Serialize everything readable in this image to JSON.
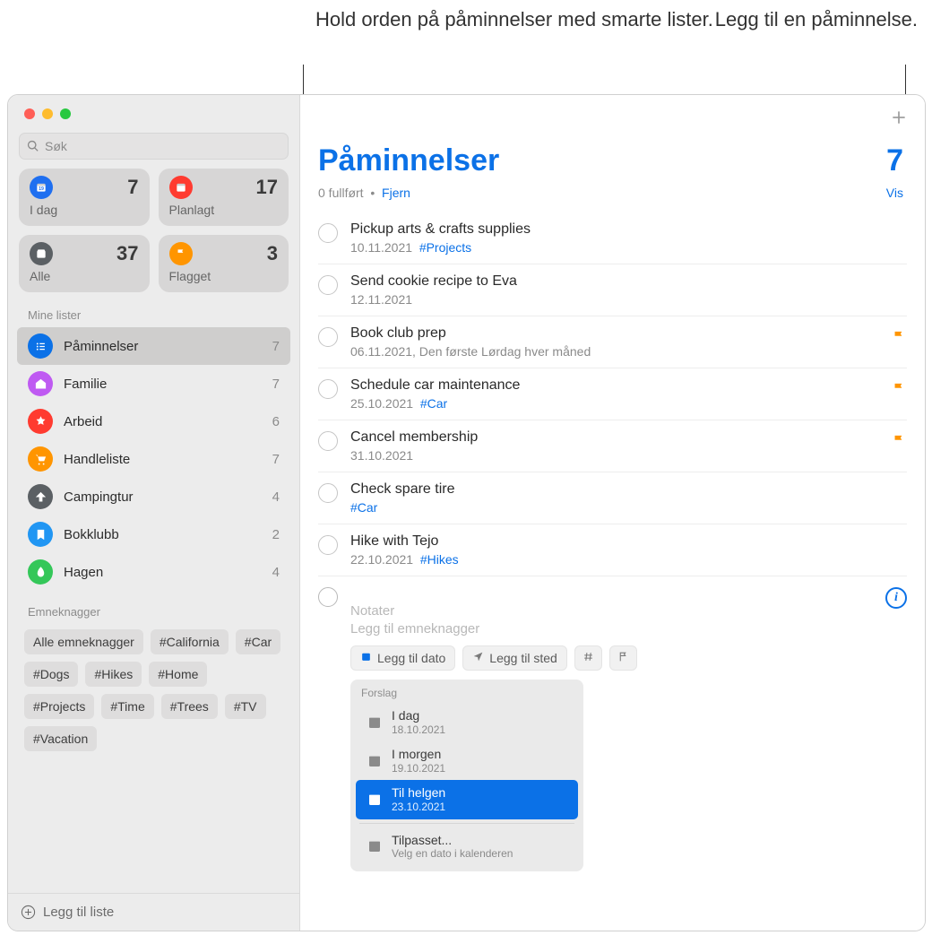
{
  "annotations": {
    "smartLists": "Hold orden på påminnelser med smarte lister.",
    "addReminder": "Legg til en påminnelse."
  },
  "sidebar": {
    "searchPlaceholder": "Søk",
    "smart": [
      {
        "label": "I dag",
        "count": "7",
        "color": "#1f6ff0"
      },
      {
        "label": "Planlagt",
        "count": "17",
        "color": "#ff3b30"
      },
      {
        "label": "Alle",
        "count": "37",
        "color": "#5b6064"
      },
      {
        "label": "Flagget",
        "count": "3",
        "color": "#ff9500"
      }
    ],
    "myListsHeader": "Mine lister",
    "lists": [
      {
        "name": "Påminnelser",
        "count": "7",
        "color": "#0b71e7",
        "selected": true
      },
      {
        "name": "Familie",
        "count": "7",
        "color": "#bf5af2"
      },
      {
        "name": "Arbeid",
        "count": "6",
        "color": "#ff3b30"
      },
      {
        "name": "Handleliste",
        "count": "7",
        "color": "#ff9500"
      },
      {
        "name": "Campingtur",
        "count": "4",
        "color": "#5b6064"
      },
      {
        "name": "Bokklubb",
        "count": "2",
        "color": "#2196f3"
      },
      {
        "name": "Hagen",
        "count": "4",
        "color": "#34c759"
      }
    ],
    "tagsHeader": "Emneknagger",
    "tags": [
      "Alle emneknagger",
      "#California",
      "#Car",
      "#Dogs",
      "#Hikes",
      "#Home",
      "#Projects",
      "#Time",
      "#Trees",
      "#TV",
      "#Vacation"
    ],
    "addList": "Legg til liste"
  },
  "main": {
    "title": "Påminnelser",
    "count": "7",
    "completedText": "0 fullført",
    "clearText": "Fjern",
    "showText": "Vis",
    "reminders": [
      {
        "title": "Pickup arts & crafts supplies",
        "date": "10.11.2021",
        "tag": "#Projects",
        "flag": false
      },
      {
        "title": "Send cookie recipe to Eva",
        "date": "12.11.2021",
        "tag": "",
        "flag": false
      },
      {
        "title": "Book club prep",
        "date": "06.11.2021, Den første Lørdag hver måned",
        "tag": "",
        "flag": true
      },
      {
        "title": "Schedule car maintenance",
        "date": "25.10.2021",
        "tag": "#Car",
        "flag": true
      },
      {
        "title": "Cancel membership",
        "date": "31.10.2021",
        "tag": "",
        "flag": true
      },
      {
        "title": "Check spare tire",
        "date": "",
        "tag": "#Car",
        "flag": false
      },
      {
        "title": "Hike with Tejo",
        "date": "22.10.2021",
        "tag": "#Hikes",
        "flag": false
      }
    ],
    "newItem": {
      "notesPlaceholder": "Notater",
      "tagsPlaceholder": "Legg til emneknagger",
      "addDate": "Legg til dato",
      "addLocation": "Legg til sted"
    },
    "suggestions": {
      "header": "Forslag",
      "items": [
        {
          "title": "I dag",
          "sub": "18.10.2021",
          "selected": false
        },
        {
          "title": "I morgen",
          "sub": "19.10.2021",
          "selected": false
        },
        {
          "title": "Til helgen",
          "sub": "23.10.2021",
          "selected": true
        }
      ],
      "custom": {
        "title": "Tilpasset...",
        "sub": "Velg en dato i kalenderen"
      }
    }
  }
}
